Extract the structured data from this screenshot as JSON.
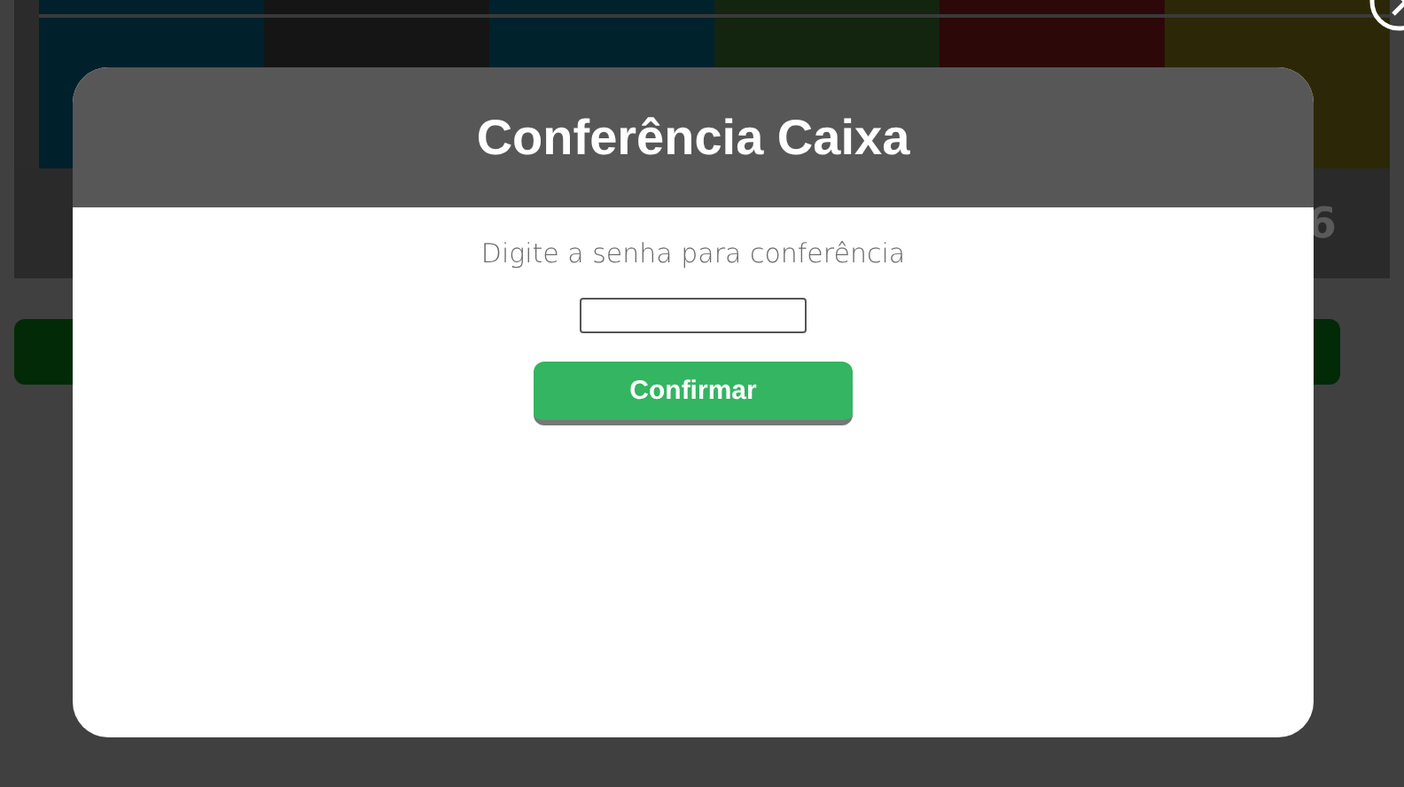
{
  "background": {
    "tiles": [
      {
        "color": "#00202b"
      },
      {
        "color": "#151515"
      },
      {
        "color": "#00222d"
      },
      {
        "color": "#13240f"
      },
      {
        "color": "#2c0808"
      },
      {
        "color": "#2c2807"
      }
    ],
    "total_fragment": "6"
  },
  "modal": {
    "title": "Conferência Caixa",
    "prompt": "Digite a senha para conferência",
    "button": "Confirmar"
  }
}
